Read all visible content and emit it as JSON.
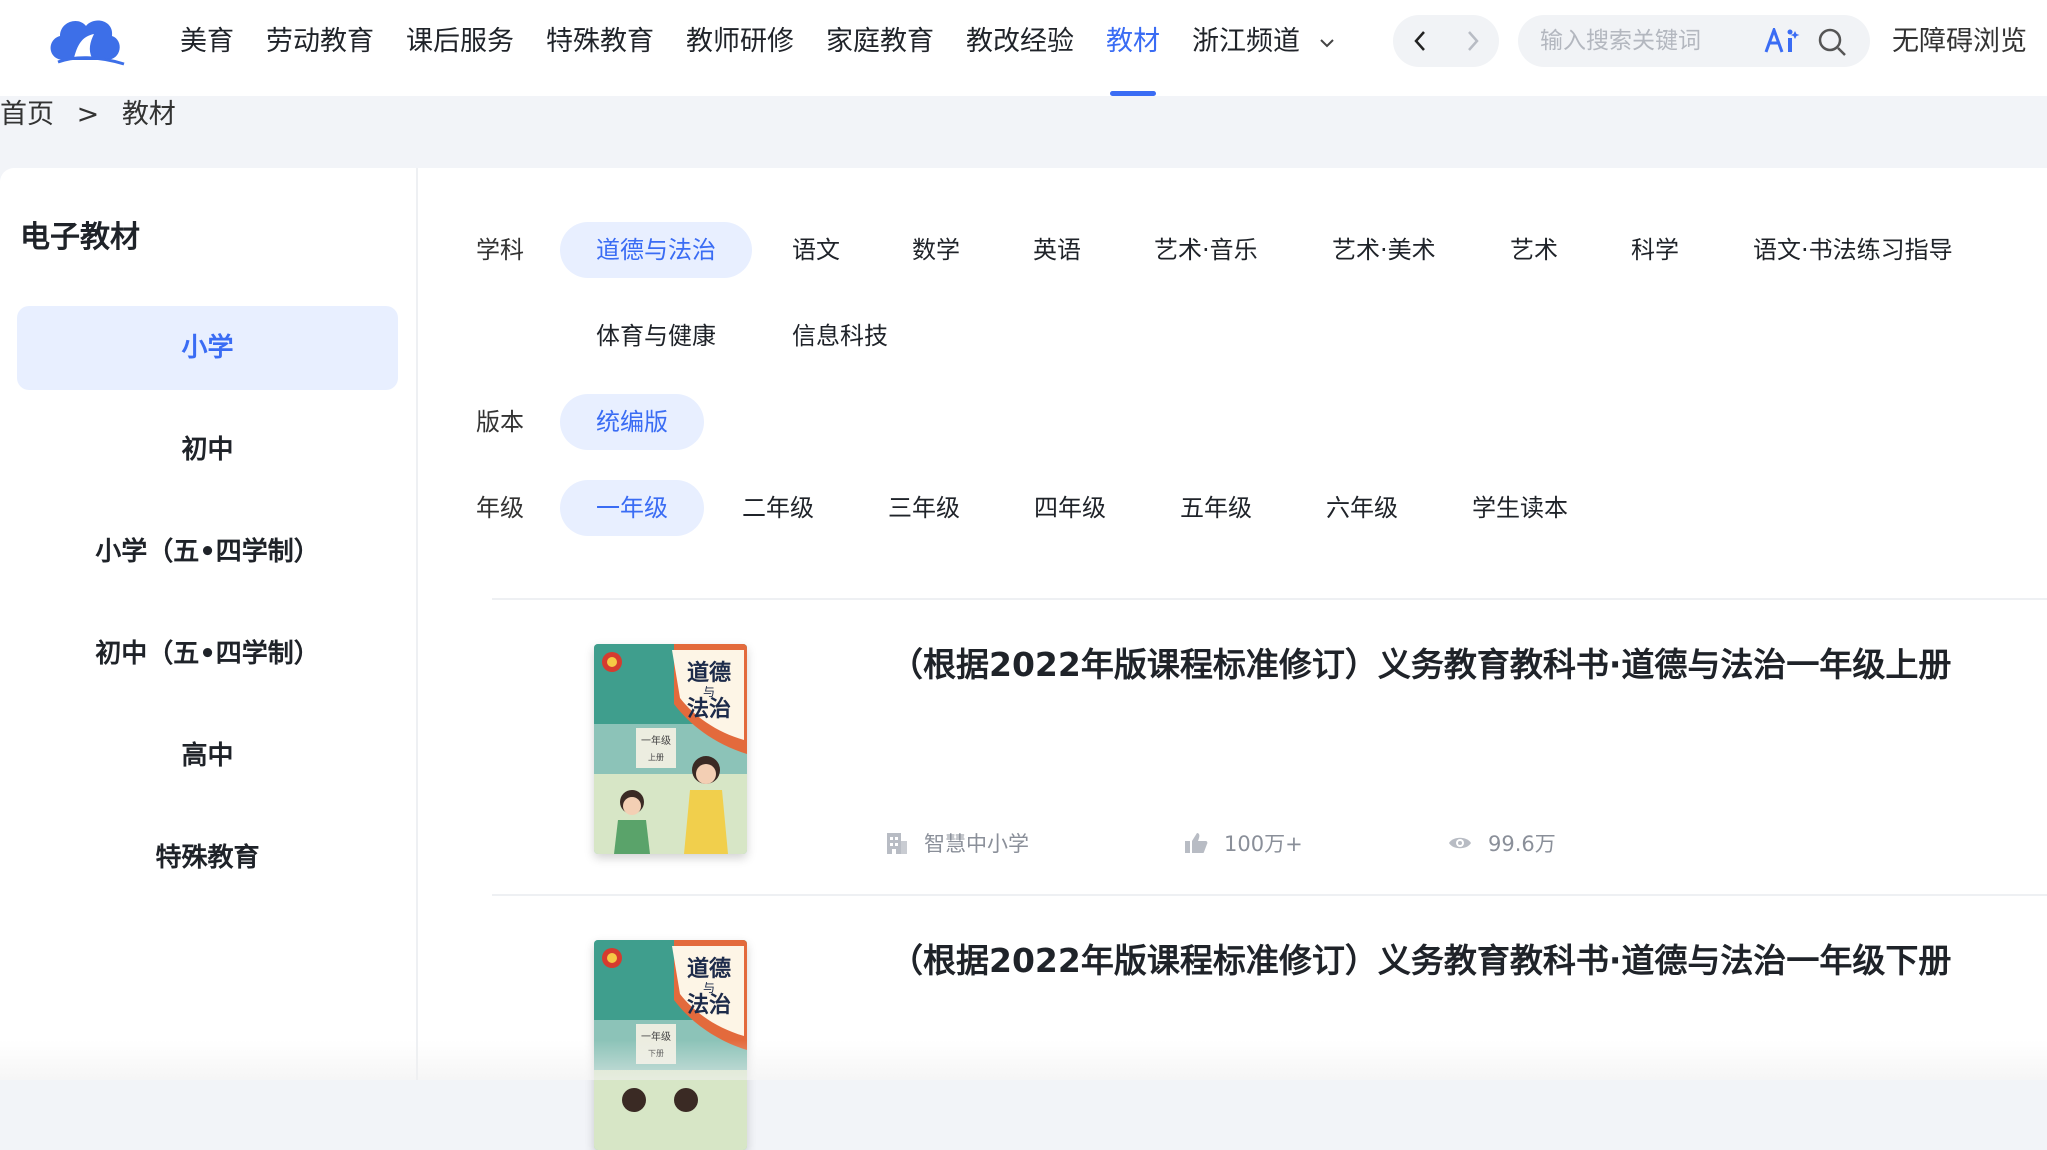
{
  "nav": {
    "items": [
      "美育",
      "劳动教育",
      "课后服务",
      "特殊教育",
      "教师研修",
      "家庭教育",
      "教改经验",
      "教材",
      "浙江频道"
    ],
    "active": "教材",
    "search_placeholder": "输入搜索关键词",
    "accessibility": "无障碍浏览",
    "accent": "#3a6cf4"
  },
  "breadcrumb": {
    "home": "首页",
    "sep": ">",
    "current": "教材"
  },
  "sidebar": {
    "title": "电子教材",
    "items": [
      "小学",
      "初中",
      "小学（五•四学制）",
      "初中（五•四学制）",
      "高中",
      "特殊教育"
    ]
  },
  "filters": {
    "subject": {
      "label": "学科",
      "options": [
        "道德与法治",
        "语文",
        "数学",
        "英语",
        "艺术·音乐",
        "艺术·美术",
        "艺术",
        "科学",
        "语文·书法练习指导",
        "体育与健康",
        "信息科技"
      ]
    },
    "edition": {
      "label": "版本",
      "options": [
        "统编版"
      ]
    },
    "grade": {
      "label": "年级",
      "options": [
        "一年级",
        "二年级",
        "三年级",
        "四年级",
        "五年级",
        "六年级",
        "学生读本"
      ]
    }
  },
  "books": [
    {
      "title": "（根据2022年版课程标准修订）义务教育教科书·道德与法治一年级上册",
      "publisher": "智慧中小学",
      "likes": "100万+",
      "views": "99.6万",
      "cover_title_1": "道德",
      "cover_title_2": "与",
      "cover_title_3": "法治",
      "cover_grade": "一年级",
      "cover_volume": "上册"
    },
    {
      "title": "（根据2022年版课程标准修订）义务教育教科书·道德与法治一年级下册",
      "cover_title_1": "道德",
      "cover_title_2": "与",
      "cover_title_3": "法治",
      "cover_grade": "一年级",
      "cover_volume": "下册"
    }
  ]
}
